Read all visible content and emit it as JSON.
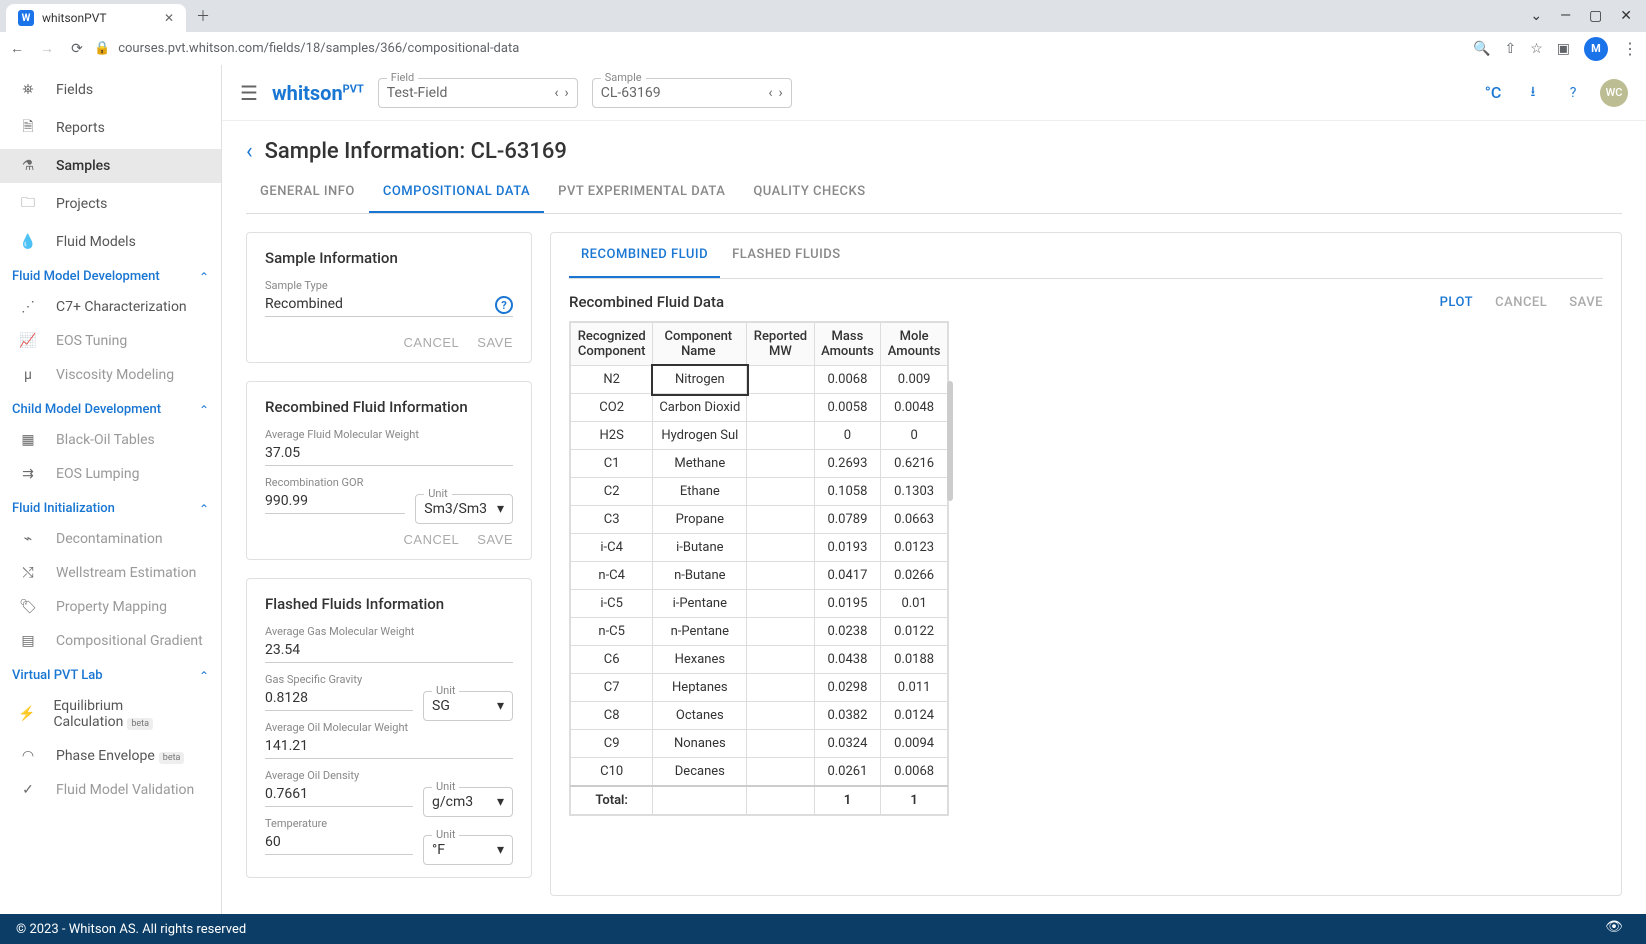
{
  "browser": {
    "tab_title": "whitsonPVT",
    "url": "courses.pvt.whitson.com/fields/18/samples/366/compositional-data",
    "profile_initial": "M"
  },
  "topbar": {
    "logo_main": "whitson",
    "logo_sup": "PVT",
    "field_label": "Field",
    "field_value": "Test-Field",
    "sample_label": "Sample",
    "sample_value": "CL-63169",
    "temp_unit": "°C",
    "avatar": "WC"
  },
  "sidebar": {
    "primary": [
      {
        "label": "Fields"
      },
      {
        "label": "Reports"
      },
      {
        "label": "Samples"
      },
      {
        "label": "Projects"
      },
      {
        "label": "Fluid Models"
      }
    ],
    "groups": [
      {
        "title": "Fluid Model Development",
        "items": [
          "C7+ Characterization",
          "EOS Tuning",
          "Viscosity Modeling"
        ]
      },
      {
        "title": "Child Model Development",
        "items": [
          "Black-Oil Tables",
          "EOS Lumping"
        ]
      },
      {
        "title": "Fluid Initialization",
        "items": [
          "Decontamination",
          "Wellstream Estimation",
          "Property Mapping",
          "Compositional Gradient"
        ]
      },
      {
        "title": "Virtual PVT Lab",
        "items": [
          "Equilibrium Calculation",
          "Phase Envelope",
          "Fluid Model Validation"
        ]
      }
    ],
    "badge_beta": "beta"
  },
  "page": {
    "title": "Sample Information: CL-63169",
    "tabs": [
      "GENERAL INFO",
      "COMPOSITIONAL DATA",
      "PVT EXPERIMENTAL DATA",
      "QUALITY CHECKS"
    ],
    "active_tab": 1
  },
  "sample_info": {
    "card_title": "Sample Information",
    "sample_type_label": "Sample Type",
    "sample_type_value": "Recombined",
    "cancel": "CANCEL",
    "save": "SAVE"
  },
  "recombined_info": {
    "card_title": "Recombined Fluid Information",
    "avg_mw_label": "Average Fluid Molecular Weight",
    "avg_mw_value": "37.05",
    "gor_label": "Recombination GOR",
    "gor_value": "990.99",
    "unit_label": "Unit",
    "gor_unit": "Sm3/Sm3",
    "cancel": "CANCEL",
    "save": "SAVE"
  },
  "flashed_info": {
    "card_title": "Flashed Fluids Information",
    "gas_mw_label": "Average Gas Molecular Weight",
    "gas_mw_value": "23.54",
    "gas_sg_label": "Gas Specific Gravity",
    "gas_sg_value": "0.8128",
    "gas_sg_unit": "SG",
    "oil_mw_label": "Average Oil Molecular Weight",
    "oil_mw_value": "141.21",
    "oil_den_label": "Average Oil Density",
    "oil_den_value": "0.7661",
    "oil_den_unit": "g/cm3",
    "temp_label": "Temperature",
    "temp_value": "60",
    "temp_unit": "°F",
    "unit_label": "Unit"
  },
  "right": {
    "subtabs": [
      "RECOMBINED FLUID",
      "FLASHED FLUIDS"
    ],
    "active_subtab": 0,
    "section_title": "Recombined Fluid Data",
    "plot": "PLOT",
    "cancel": "CANCEL",
    "save": "SAVE",
    "cols": [
      "Recognized Component",
      "Component Name",
      "Reported MW",
      "Mass Amounts",
      "Mole Amounts"
    ],
    "rows": [
      {
        "rc": "N2",
        "name": "Nitrogen",
        "mw": "",
        "mass": "0.0068",
        "mole": "0.009"
      },
      {
        "rc": "CO2",
        "name": "Carbon Dioxid",
        "mw": "",
        "mass": "0.0058",
        "mole": "0.0048"
      },
      {
        "rc": "H2S",
        "name": "Hydrogen Sul",
        "mw": "",
        "mass": "0",
        "mole": "0"
      },
      {
        "rc": "C1",
        "name": "Methane",
        "mw": "",
        "mass": "0.2693",
        "mole": "0.6216"
      },
      {
        "rc": "C2",
        "name": "Ethane",
        "mw": "",
        "mass": "0.1058",
        "mole": "0.1303"
      },
      {
        "rc": "C3",
        "name": "Propane",
        "mw": "",
        "mass": "0.0789",
        "mole": "0.0663"
      },
      {
        "rc": "i-C4",
        "name": "i-Butane",
        "mw": "",
        "mass": "0.0193",
        "mole": "0.0123"
      },
      {
        "rc": "n-C4",
        "name": "n-Butane",
        "mw": "",
        "mass": "0.0417",
        "mole": "0.0266"
      },
      {
        "rc": "i-C5",
        "name": "i-Pentane",
        "mw": "",
        "mass": "0.0195",
        "mole": "0.01"
      },
      {
        "rc": "n-C5",
        "name": "n-Pentane",
        "mw": "",
        "mass": "0.0238",
        "mole": "0.0122"
      },
      {
        "rc": "C6",
        "name": "Hexanes",
        "mw": "",
        "mass": "0.0438",
        "mole": "0.0188"
      },
      {
        "rc": "C7",
        "name": "Heptanes",
        "mw": "",
        "mass": "0.0298",
        "mole": "0.011"
      },
      {
        "rc": "C8",
        "name": "Octanes",
        "mw": "",
        "mass": "0.0382",
        "mole": "0.0124"
      },
      {
        "rc": "C9",
        "name": "Nonanes",
        "mw": "",
        "mass": "0.0324",
        "mole": "0.0094"
      },
      {
        "rc": "C10",
        "name": "Decanes",
        "mw": "",
        "mass": "0.0261",
        "mole": "0.0068"
      }
    ],
    "total_label": "Total:",
    "total_mass": "1",
    "total_mole": "1"
  },
  "footer": {
    "copyright": "© 2023 - Whitson AS. All rights reserved"
  }
}
